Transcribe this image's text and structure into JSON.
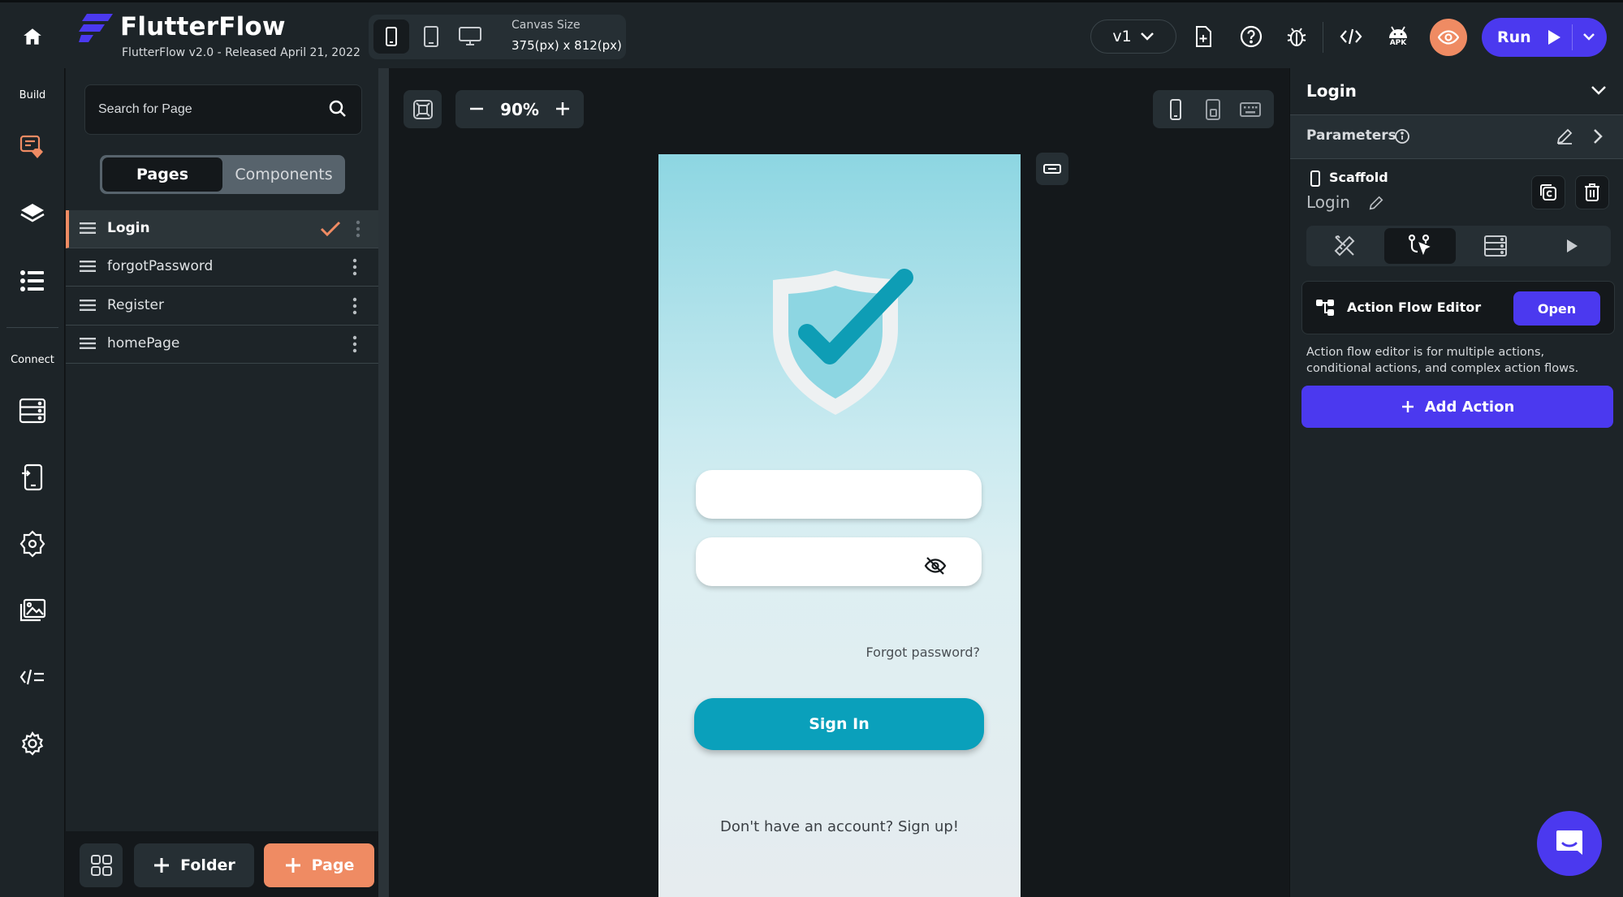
{
  "brand": {
    "title": "FlutterFlow",
    "subtitle": "FlutterFlow v2.0 - Released April 21, 2022",
    "logo_color": "#4b39ef"
  },
  "toolbar": {
    "canvas_size_label": "Canvas Size",
    "canvas_size_value": "375(px) x 812(px)",
    "version": "v1",
    "run_label": "Run",
    "apk_label": "APK",
    "preview_color": "#ef8b63",
    "run_color": "#4b39ef",
    "icons": [
      "home-icon",
      "phone-icon",
      "tablet-icon",
      "desktop-icon",
      "add-file-icon",
      "help-icon",
      "bug-icon",
      "code-icon",
      "android-icon",
      "eye-icon",
      "play-icon",
      "chevron-down-icon"
    ]
  },
  "rail": {
    "build_label": "Build",
    "connect_label": "Connect",
    "icons": [
      "widget-palette-icon",
      "layers-icon",
      "tree-icon",
      "database-icon",
      "app-state-icon",
      "integrations-icon",
      "media-assets-icon",
      "custom-code-icon",
      "settings-icon"
    ]
  },
  "pages_panel": {
    "search_placeholder": "Search for Page",
    "tab_pages": "Pages",
    "tab_components": "Components",
    "pages": [
      {
        "label": "Login",
        "selected": true
      },
      {
        "label": "forgotPassword",
        "selected": false
      },
      {
        "label": "Register",
        "selected": false
      },
      {
        "label": "homePage",
        "selected": false
      }
    ],
    "folder_label": "Folder",
    "page_label": "Page",
    "accent": "#ef8b63"
  },
  "canvas": {
    "zoom": "90%",
    "forgot_password": "Forgot password?",
    "sign_in": "Sign In",
    "signup_prompt": "Don't have an account? Sign up!",
    "button_color": "#0aa0bb"
  },
  "properties": {
    "title": "Login",
    "parameters_label": "Parameters",
    "scaffold_label": "Scaffold",
    "scaffold_name": "Login",
    "action_flow_label": "Action Flow Editor",
    "open_label": "Open",
    "description": "Action flow editor is for multiple actions, conditional actions, and complex action flows.",
    "add_action_label": "Add Action"
  }
}
